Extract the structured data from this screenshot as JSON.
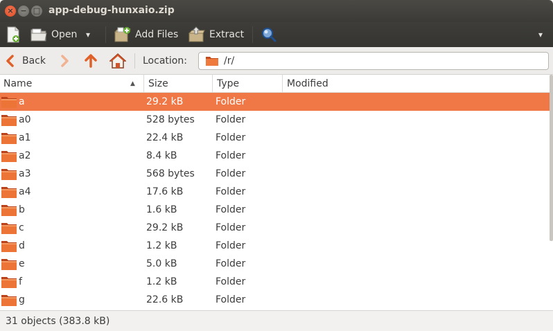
{
  "window": {
    "title": "app-debug-hunxaio.zip",
    "close_glyph": "×",
    "minimize_glyph": "−",
    "maximize_glyph": "□"
  },
  "toolbar": {
    "new_icon": "new-archive-icon",
    "open_label": "Open",
    "open_arrow": "▾",
    "add_files_label": "Add Files",
    "extract_label": "Extract",
    "search_icon": "search-icon",
    "menu_arrow": "▾"
  },
  "location": {
    "back_label": "Back",
    "label": "Location:",
    "path": "/r/"
  },
  "columns": {
    "name": "Name",
    "size": "Size",
    "type": "Type",
    "modified": "Modified",
    "sort_arrow": "▲"
  },
  "rows": [
    {
      "name": "a",
      "size": "29.2 kB",
      "type": "Folder"
    },
    {
      "name": "a0",
      "size": "528 bytes",
      "type": "Folder"
    },
    {
      "name": "a1",
      "size": "22.4 kB",
      "type": "Folder"
    },
    {
      "name": "a2",
      "size": "8.4 kB",
      "type": "Folder"
    },
    {
      "name": "a3",
      "size": "568 bytes",
      "type": "Folder"
    },
    {
      "name": "a4",
      "size": "17.6 kB",
      "type": "Folder"
    },
    {
      "name": "b",
      "size": "1.6 kB",
      "type": "Folder"
    },
    {
      "name": "c",
      "size": "29.2 kB",
      "type": "Folder"
    },
    {
      "name": "d",
      "size": "1.2 kB",
      "type": "Folder"
    },
    {
      "name": "e",
      "size": "5.0 kB",
      "type": "Folder"
    },
    {
      "name": "f",
      "size": "1.2 kB",
      "type": "Folder"
    },
    {
      "name": "g",
      "size": "22.6 kB",
      "type": "Folder"
    }
  ],
  "selected_row": 0,
  "status": {
    "text": "31 objects (383.8 kB)"
  },
  "colors": {
    "accent": "#f07746",
    "folder": "#e5652b",
    "titlebar": "#3c3b37"
  }
}
